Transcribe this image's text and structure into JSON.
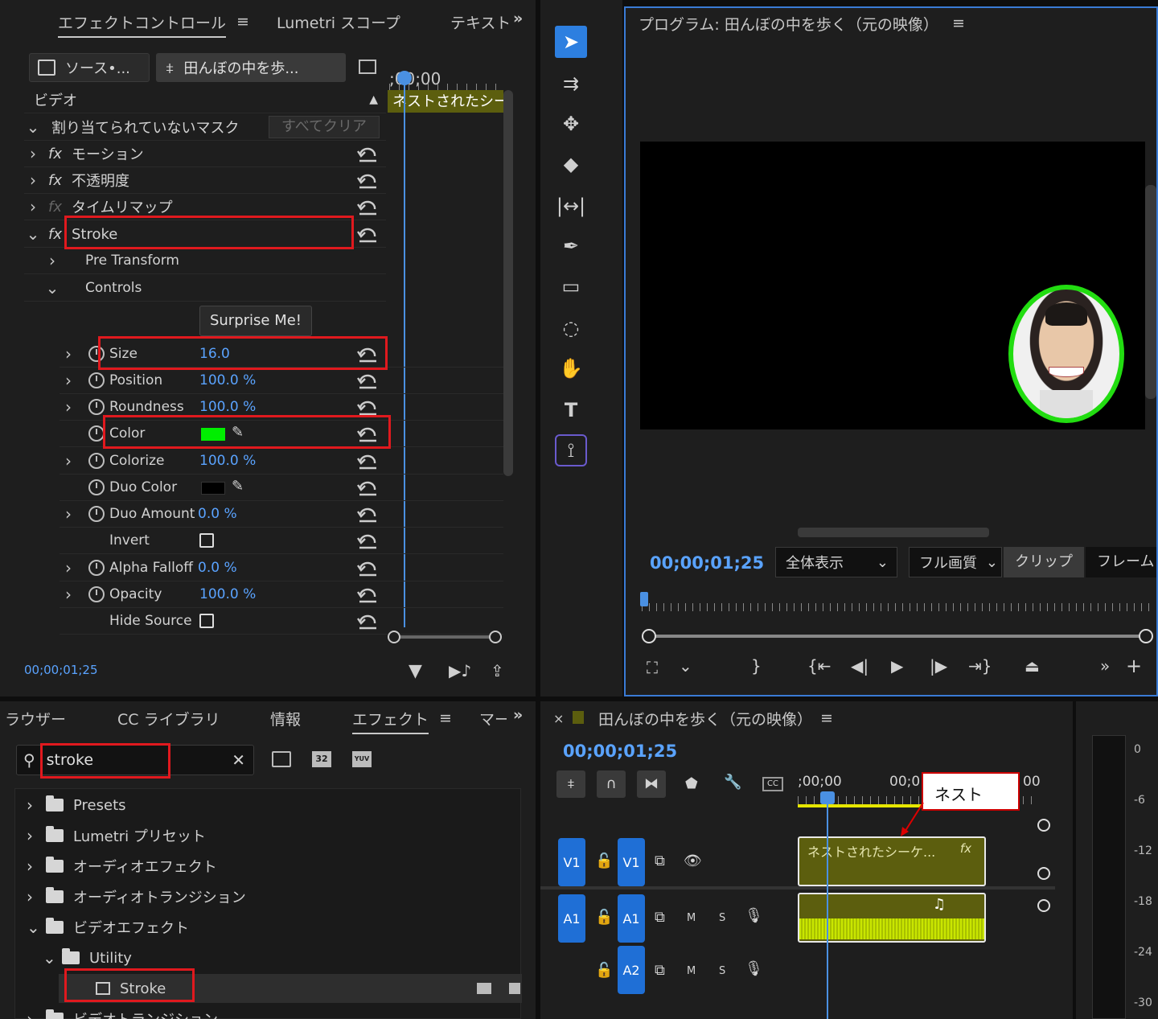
{
  "effect_controls": {
    "tabs": [
      "エフェクトコントロール",
      "Lumetri スコープ",
      "テキスト"
    ],
    "more": "»",
    "source_label": "ソース•...",
    "clip_label": "田んぼの中を歩...",
    "timecode_ruler": ";00;00",
    "nested_clip": "ネストされたシー",
    "section_video": "ビデオ",
    "mask_label": "割り当てられていないマスク",
    "clear_all": "すべてクリア",
    "effects": [
      {
        "name": "モーション",
        "fx": "fx"
      },
      {
        "name": "不透明度",
        "fx": "fx"
      },
      {
        "name": "タイムリマップ",
        "fx": "fx"
      },
      {
        "name": "Stroke",
        "fx": "fx"
      }
    ],
    "pre_transform": "Pre Transform",
    "controls": "Controls",
    "surprise": "Surprise Me!",
    "params": [
      {
        "name": "Size",
        "value": "16.0"
      },
      {
        "name": "Position",
        "value": "100.0 %"
      },
      {
        "name": "Roundness",
        "value": "100.0 %"
      },
      {
        "name": "Color",
        "value": ""
      },
      {
        "name": "Colorize",
        "value": "100.0 %"
      },
      {
        "name": "Duo Color",
        "value": ""
      },
      {
        "name": "Duo Amount",
        "value": "0.0 %"
      },
      {
        "name": "Invert",
        "value": ""
      },
      {
        "name": "Alpha Falloff",
        "value": "0.0 %"
      },
      {
        "name": "Opacity",
        "value": "100.0 %"
      },
      {
        "name": "Hide Source",
        "value": ""
      }
    ],
    "current_time": "00;00;01;25",
    "stroke_color": "#00ee00"
  },
  "program": {
    "title": "プログラム: 田んぼの中を歩く（元の映像）",
    "timecode": "00;00;01;25",
    "zoom": "全体表示",
    "quality": "フル画質",
    "tab_clip": "クリップ",
    "tab_frame": "フレーム"
  },
  "effects_panel": {
    "tabs": [
      "ラウザー",
      "CC ライブラリ",
      "情報",
      "エフェクト",
      "マー"
    ],
    "more": "»",
    "search": "stroke",
    "tree": [
      {
        "label": "Presets",
        "type": "preset"
      },
      {
        "label": "Lumetri プリセット",
        "type": "preset"
      },
      {
        "label": "オーディオエフェクト",
        "type": "folder"
      },
      {
        "label": "オーディオトランジション",
        "type": "folder"
      },
      {
        "label": "ビデオエフェクト",
        "type": "folder"
      },
      {
        "label": "Utility",
        "type": "folder"
      },
      {
        "label": "Stroke",
        "type": "effect"
      },
      {
        "label": "ビデオトランジション",
        "type": "folder"
      }
    ]
  },
  "timeline": {
    "close": "×",
    "title": "田んぼの中を歩く（元の映像）",
    "timecode": "00;00;01;25",
    "ruler_start": ";00;00",
    "ruler_mid": "00;0",
    "ruler_end": "00",
    "clip_label": "ネストされたシーケ...",
    "clip_fx": "fx",
    "callout": "ネスト",
    "tracks": {
      "v1": "V1",
      "a1": "A1",
      "a2": "A2",
      "m": "M",
      "s": "S"
    },
    "meter": [
      "0",
      "-6",
      "-12",
      "-18",
      "-24",
      "-30"
    ]
  }
}
